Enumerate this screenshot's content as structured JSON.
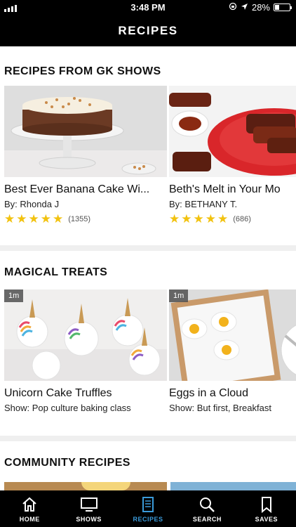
{
  "status": {
    "time": "3:48 PM",
    "battery": "28%",
    "battery_level": 0.28
  },
  "header": {
    "title": "RECIPES"
  },
  "sections": [
    {
      "title": "RECIPES FROM GK SHOWS",
      "cards": [
        {
          "title": "Best Ever Banana Cake Wi...",
          "meta_prefix": "By:",
          "meta_value": "Rhonda J",
          "rating": 5,
          "rating_count": "(1355)"
        },
        {
          "title": "Beth's Melt in Your Mo",
          "meta_prefix": "By:",
          "meta_value": "BETHANY T.",
          "rating": 5,
          "rating_count": "(686)"
        }
      ]
    },
    {
      "title": "MAGICAL TREATS",
      "cards": [
        {
          "duration": "1m",
          "title": "Unicorn Cake Truffles",
          "meta_prefix": "Show:",
          "meta_value": "Pop culture baking class"
        },
        {
          "duration": "1m",
          "title": "Eggs in a Cloud",
          "meta_prefix": "Show:",
          "meta_value": "But first, Breakfast"
        }
      ]
    },
    {
      "title": "COMMUNITY RECIPES"
    }
  ],
  "tabs": [
    {
      "label": "HOME",
      "icon": "home-icon"
    },
    {
      "label": "SHOWS",
      "icon": "tv-icon"
    },
    {
      "label": "RECIPES",
      "icon": "recipe-book-icon",
      "active": true
    },
    {
      "label": "SEARCH",
      "icon": "search-icon"
    },
    {
      "label": "SAVES",
      "icon": "bookmark-icon"
    }
  ],
  "colors": {
    "star": "#f2c20f",
    "active_tab": "#3a9ad9",
    "bar": "#000000"
  }
}
